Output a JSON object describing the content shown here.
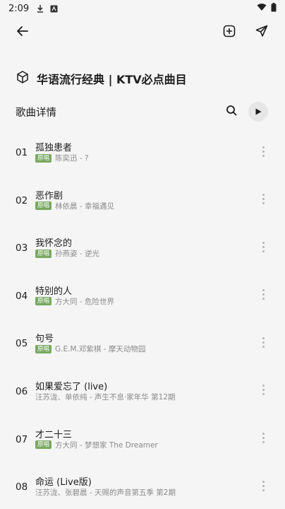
{
  "status": {
    "time": "2:09",
    "icons": [
      "download-icon",
      "app-notification-icon",
      "wifi-icon",
      "battery-icon"
    ]
  },
  "toolbar": {
    "back_icon": "arrow-left-icon",
    "add_icon": "plus-square-icon",
    "share_icon": "send-icon"
  },
  "playlist": {
    "icon": "cube-icon",
    "title": "华语流行经典 | KTV必点曲目"
  },
  "section": {
    "label": "歌曲详情",
    "search_icon": "search-icon",
    "play_icon": "play-icon"
  },
  "colors": {
    "background": "#f5f5f5",
    "badge_green": "#7aa861",
    "meta_gray": "#8a8a8a",
    "play_button_bg": "#e6e6e6"
  },
  "songs": [
    {
      "num": "01",
      "title": "孤独患者",
      "badge": "原唱",
      "meta": "陈奕迅 - ?"
    },
    {
      "num": "02",
      "title": "恶作剧",
      "badge": "原唱",
      "meta": "林依晨 - 幸福遇见"
    },
    {
      "num": "03",
      "title": "我怀念的",
      "badge": "原唱",
      "meta": "孙燕姿 - 逆光"
    },
    {
      "num": "04",
      "title": "特别的人",
      "badge": "原唱",
      "meta": "方大同 - 危险世界"
    },
    {
      "num": "05",
      "title": "句号",
      "badge": "原唱",
      "meta": "G.E.M.邓紫棋 - 摩天动物园"
    },
    {
      "num": "06",
      "title": "如果爱忘了 (live)",
      "badge": "",
      "meta": "汪苏泷、单依纯 - 声生不息·家年华 第12期"
    },
    {
      "num": "07",
      "title": "才二十三",
      "badge": "原唱",
      "meta": "方大同 - 梦想家 The Dreamer"
    },
    {
      "num": "08",
      "title": "命运 (Live版)",
      "badge": "",
      "meta": "汪苏泷、张碧晨 - 天赐的声音第五季 第2期"
    }
  ]
}
